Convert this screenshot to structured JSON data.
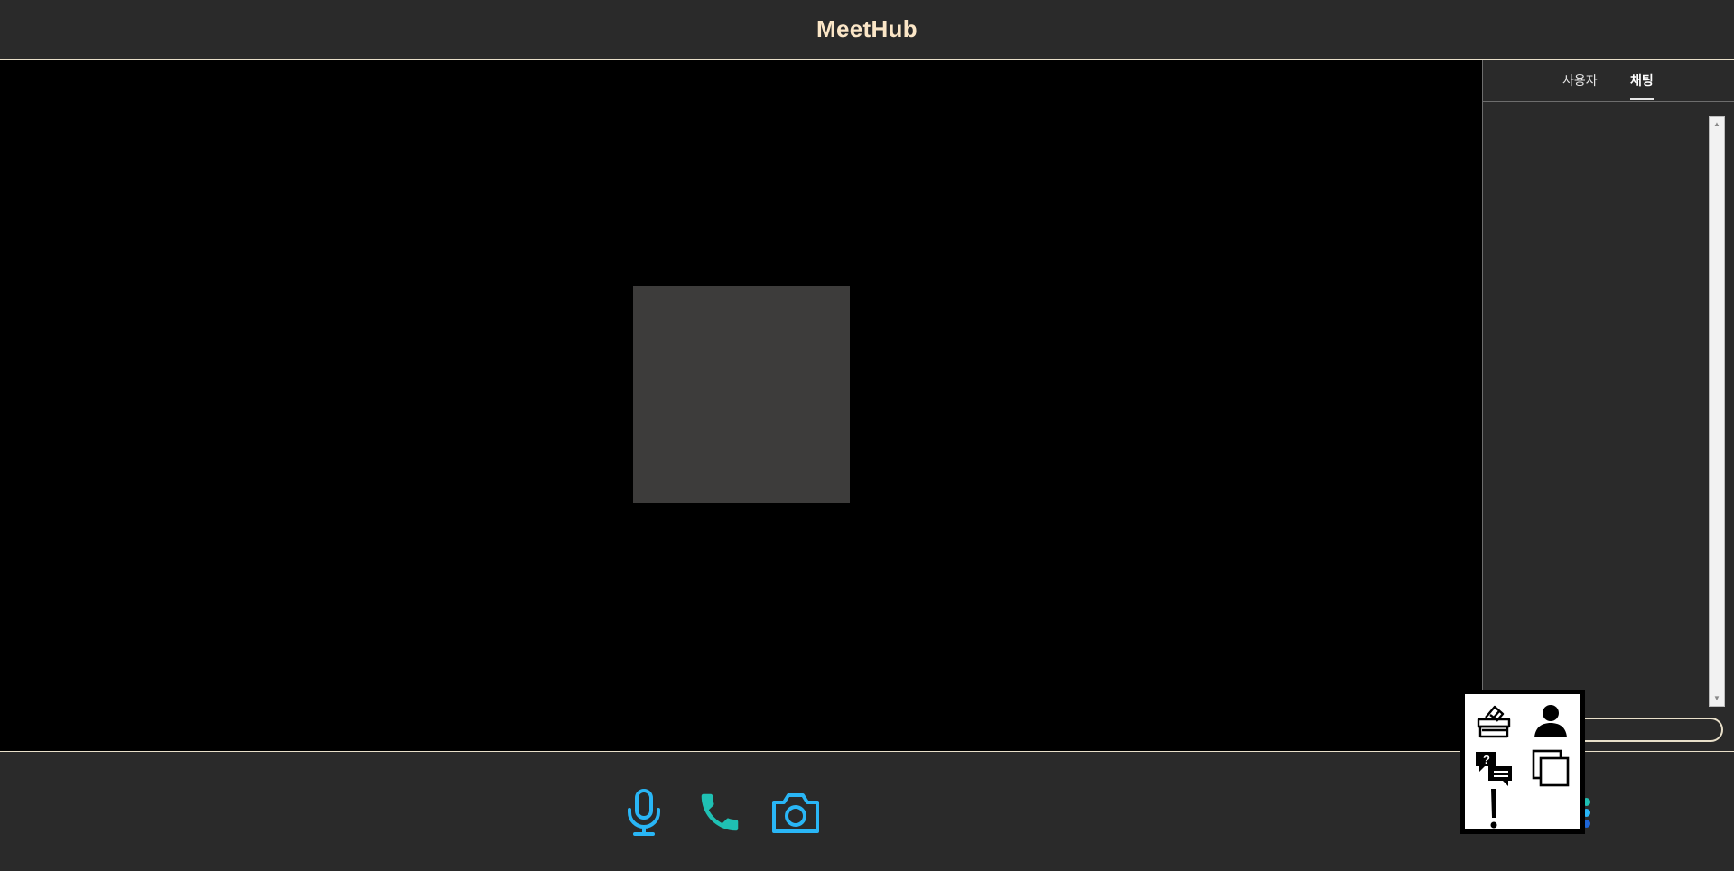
{
  "header": {
    "title": "MeetHub"
  },
  "sidebar": {
    "tabs": [
      {
        "label": "사용자",
        "active": false
      },
      {
        "label": "채팅",
        "active": true
      }
    ],
    "chat_input": {
      "value": "",
      "placeholder": ""
    }
  },
  "controls": {
    "mic_icon": "microphone-icon",
    "call_icon": "phone-icon",
    "camera_icon": "camera-icon"
  },
  "tools": [
    "ballot-box-icon",
    "user-icon",
    "qna-chat-icon",
    "layers-icon",
    "alert-icon"
  ],
  "colors": {
    "background": "#2a2a2a",
    "stage": "#000000",
    "video_tile": "#3d3c3b",
    "brand_text": "#fbe6c7",
    "accent_blue": "#29b6f6",
    "accent_teal": "#1fc0b3"
  }
}
